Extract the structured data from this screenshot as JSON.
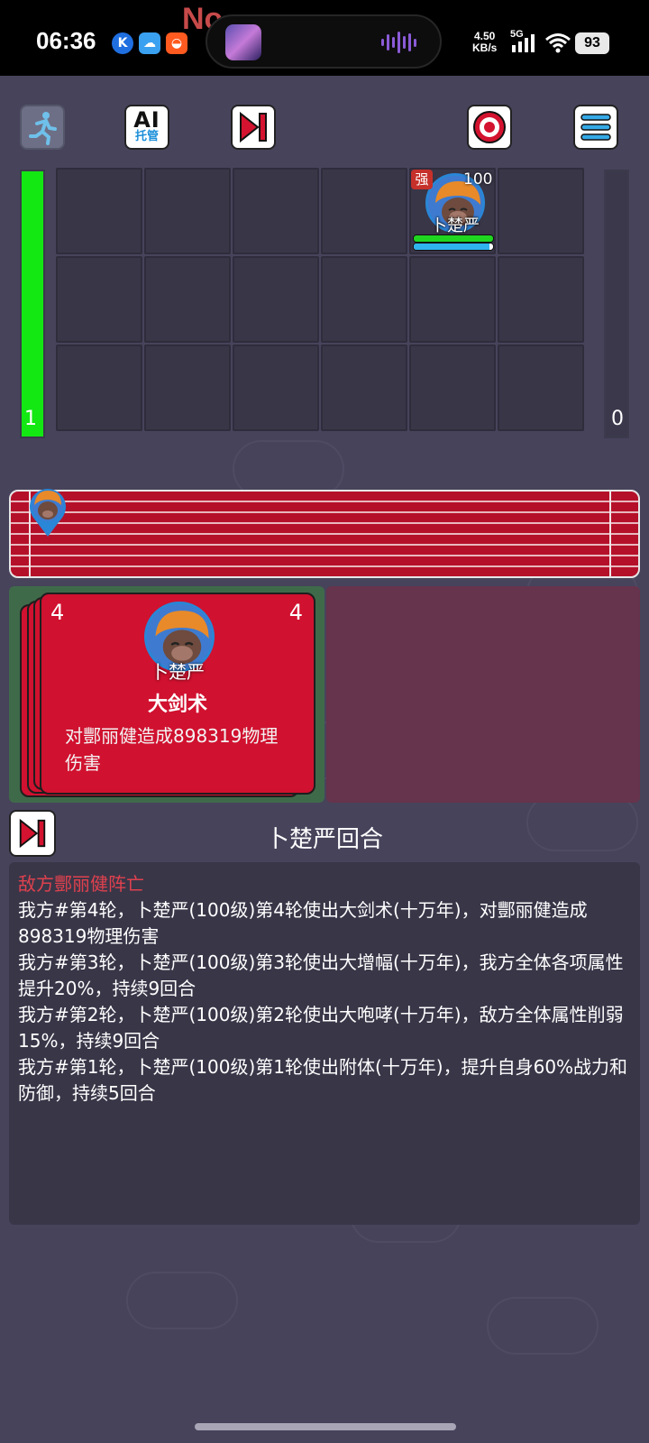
{
  "status_bar": {
    "time": "06:36",
    "net_speed_value": "4.50",
    "net_speed_unit": "KB/s",
    "network": "5G",
    "battery": "93",
    "overlay_text": "No"
  },
  "toolbar": {
    "ai_label": "AI",
    "ai_sub": "托管",
    "icons": [
      "flee-icon",
      "ai-auto-icon",
      "skip-icon",
      "target-icon",
      "menu-icon"
    ]
  },
  "battlefield": {
    "left_count": "1",
    "right_count": "0",
    "left_bar_fill": 1.0,
    "right_bar_fill": 0.0,
    "unit": {
      "badge": "强",
      "level": "100",
      "name": "卜楚严",
      "hp_fill": 1.0,
      "energy_fill": 0.95
    }
  },
  "card": {
    "stack_count": "4",
    "cost": "4",
    "hero": "卜楚严",
    "skill": "大剑术",
    "description": "对酆丽健造成898319物理伤害"
  },
  "turn_title": "卜楚严回合",
  "log": [
    {
      "type": "enemy",
      "text": "敌方酆丽健阵亡"
    },
    {
      "type": "normal",
      "text": "我方#第4轮，卜楚严(100级)第4轮使出大剑术(十万年)，对酆丽健造成898319物理伤害"
    },
    {
      "type": "normal",
      "text": "我方#第3轮，卜楚严(100级)第3轮使出大增幅(十万年)，我方全体各项属性提升20%，持续9回合"
    },
    {
      "type": "normal",
      "text": "我方#第2轮，卜楚严(100级)第2轮使出大咆哮(十万年)，敌方全体属性削弱15%，持续9回合"
    },
    {
      "type": "normal",
      "text": "我方#第1轮，卜楚严(100级)第1轮使出附体(十万年)，提升自身60%战力和防御，持续5回合"
    }
  ],
  "colors": {
    "background": "#47435b",
    "hp_green": "#13e813",
    "card_red": "#d0112f",
    "enemy_text": "#e0414e"
  }
}
